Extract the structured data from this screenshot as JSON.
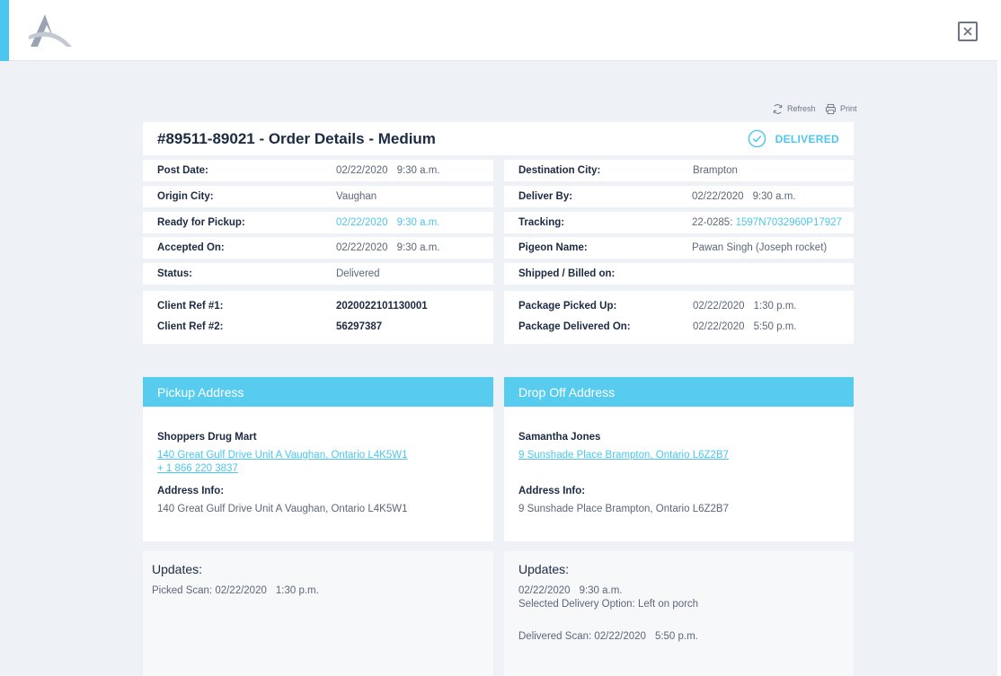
{
  "app": {
    "brand_color": "#4cc6ee",
    "logo_icon": "brand-logo",
    "close_icon": "close-icon"
  },
  "toolbar": {
    "refresh_label": "Refresh",
    "print_label": "Print"
  },
  "order": {
    "title": "#89511-89021 - Order Details - Medium",
    "status": "DELIVERED"
  },
  "left_details": [
    {
      "label": "Post Date:",
      "date": "02/22/2020",
      "time": "9:30 a.m."
    },
    {
      "label": "Origin City:",
      "value": "Vaughan"
    },
    {
      "label": "Ready for Pickup:",
      "date": "02/22/2020",
      "time": "9:30 a.m."
    },
    {
      "label": "Accepted On:",
      "date": "02/22/2020",
      "time": "9:30 a.m."
    },
    {
      "label": "Status:",
      "value": "Delivered"
    }
  ],
  "right_details": [
    {
      "label": "Destination City:",
      "value": "Brampton"
    },
    {
      "label": "Deliver By:",
      "date": "02/22/2020",
      "time": "9:30 a.m."
    },
    {
      "label": "Tracking:",
      "prefix": "22-0285:",
      "link": "1597N7032960P17927"
    },
    {
      "label": "Pigeon Name:",
      "value": "Pawan Singh (Joseph rocket)"
    },
    {
      "label": "Shipped / Billed on:",
      "value": ""
    }
  ],
  "client_refs": [
    {
      "label": "Client Ref #1:",
      "value": "2020022101130001"
    },
    {
      "label": "Client Ref #2:",
      "value": "56297387"
    }
  ],
  "package_times": [
    {
      "label": "Package Picked Up:",
      "date": "02/22/2020",
      "time": "1:30 p.m."
    },
    {
      "label": "Package Delivered On:",
      "date": "02/22/2020",
      "time": "5:50 p.m."
    }
  ],
  "pickup": {
    "heading": "Pickup Address",
    "name": "Shoppers Drug Mart",
    "address_link": "140 Great Gulf Drive Unit A Vaughan, Ontario L4K5W1",
    "phone_link": "+ 1 866 220 3837",
    "info_label": "Address Info:",
    "info_value": "140 Great Gulf Drive Unit A Vaughan, Ontario L4K5W1"
  },
  "dropoff": {
    "heading": "Drop Off Address",
    "name": "Samantha Jones",
    "address_link": "9 Sunshade Place Brampton, Ontario L6Z2B7",
    "info_label": "Address Info:",
    "info_value": "9 Sunshade Place Brampton, Ontario L6Z2B7"
  },
  "updates_left": {
    "heading": "Updates:",
    "lines": [
      "Picked Scan: 02/22/2020",
      "1:30 p.m."
    ]
  },
  "updates_right": {
    "heading": "Updates:",
    "line1_date": "02/22/2020",
    "line1_time": "9:30 a.m.",
    "line2": "Selected Delivery Option: Left on porch",
    "line3_label": "Delivered Scan: 02/22/2020",
    "line3_time": "5:50 p.m."
  }
}
